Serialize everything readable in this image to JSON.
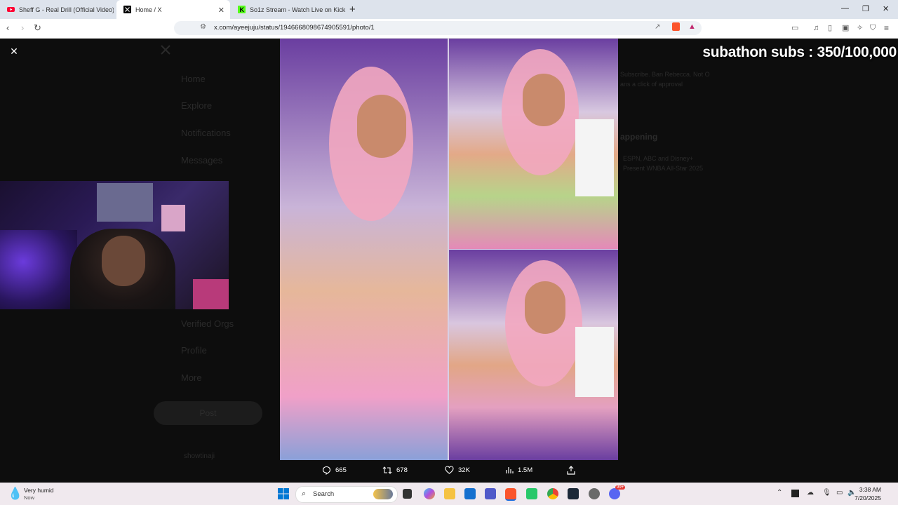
{
  "browser": {
    "tabs": [
      {
        "title": "Sheff G - Real Drill (Official Video) - ",
        "icon": "youtube-icon",
        "active": false
      },
      {
        "title": "Home / X",
        "icon": "x-logo-icon",
        "active": true
      },
      {
        "title": "So1z Stream - Watch Live on Kick",
        "icon": "kick-icon",
        "active": false
      }
    ],
    "url": "x.com/ayeejuju/status/1946668098674905591/photo/1"
  },
  "viewer": {
    "overlay_text": "subathon subs : 350/100,000",
    "ghost_nav": [
      "Home",
      "Explore",
      "Notifications",
      "Messages",
      "Verified Orgs",
      "Profile",
      "More"
    ],
    "ghost_post_label": "Post",
    "ghost_side": {
      "subscribe_text_1": "Subscribe. Ban Rebecca. Not O",
      "subscribe_text_2": "ans a click of approval",
      "heading": "appening",
      "trend_1": "ESPN, ABC and Disney+",
      "trend_2": "Present WNBA All-Star 2025"
    },
    "ghost_user": "showtinaji"
  },
  "actions": {
    "replies": "665",
    "reposts": "678",
    "likes": "32K",
    "views": "1.5M"
  },
  "taskbar": {
    "weather_title": "Very humid",
    "weather_sub": "Now",
    "search_placeholder": "Search",
    "time": "3:38 AM",
    "date": "7/20/2025",
    "notification_badge": "99+"
  }
}
